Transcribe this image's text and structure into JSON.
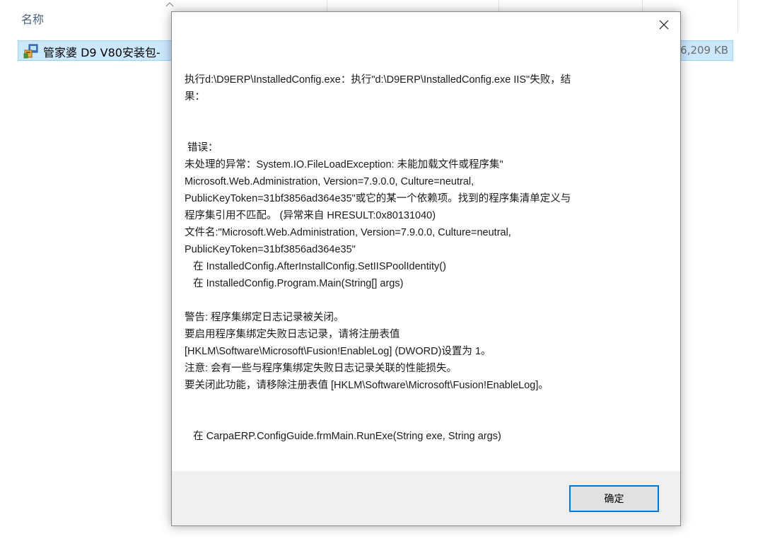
{
  "explorer": {
    "columns": {
      "name": "名称"
    },
    "file": {
      "name": "管家婆 D9 V80安装包-",
      "size": "6,209 KB"
    }
  },
  "dialog": {
    "lines": {
      "l1": "执行d:\\D9ERP\\InstalledConfig.exe：执行\"d:\\D9ERP\\InstalledConfig.exe IIS\"失败，结",
      "l2": "果：",
      "l3": " 错误：",
      "l4": "未处理的异常：System.IO.FileLoadException: 未能加载文件或程序集\"",
      "l5": "Microsoft.Web.Administration, Version=7.9.0.0, Culture=neutral,",
      "l6": "PublicKeyToken=31bf3856ad364e35\"或它的某一个依赖项。找到的程序集清单定义与",
      "l7": "程序集引用不匹配。 (异常来自 HRESULT:0x80131040)",
      "l8": "文件名:\"Microsoft.Web.Administration, Version=7.9.0.0, Culture=neutral,",
      "l9": "PublicKeyToken=31bf3856ad364e35\"",
      "l10": "   在 InstalledConfig.AfterInstallConfig.SetIISPoolIdentity()",
      "l11": "   在 InstalledConfig.Program.Main(String[] args)",
      "l12": "警告: 程序集绑定日志记录被关闭。",
      "l13": "要启用程序集绑定失败日志记录，请将注册表值",
      "l14": "[HKLM\\Software\\Microsoft\\Fusion!EnableLog] (DWORD)设置为 1。",
      "l15": "注意: 会有一些与程序集绑定失败日志记录关联的性能损失。",
      "l16": "要关闭此功能，请移除注册表值 [HKLM\\Software\\Microsoft\\Fusion!EnableLog]。",
      "l17": "   在 CarpaERP.ConfigGuide.frmMain.RunExe(String exe, String args)"
    },
    "ok_label": "确定"
  },
  "colors": {
    "selection_bg": "#cce8ff",
    "selection_border": "#99d1ff",
    "footer_bg": "#f0f0f0",
    "focus_border": "#0078d7"
  },
  "icons": {
    "file": "installer-package-icon",
    "close": "close-icon",
    "sort": "chevron-up-icon"
  }
}
